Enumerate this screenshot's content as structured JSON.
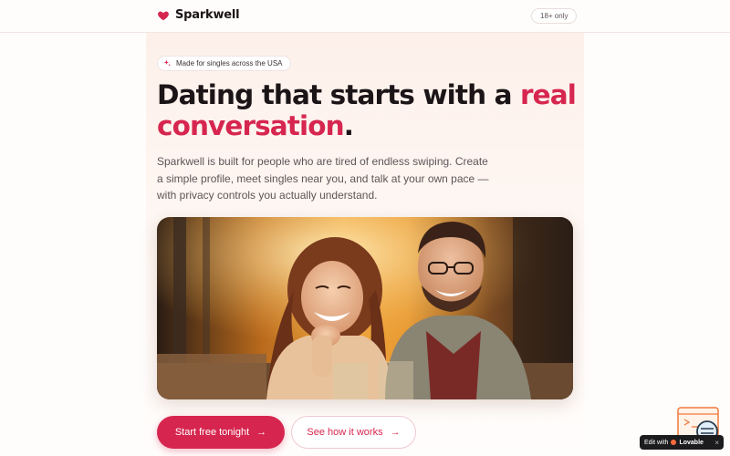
{
  "header": {
    "brand_name": "Sparkwell",
    "age_badge": "18+ only"
  },
  "hero": {
    "pill_text": "Made for singles across the USA",
    "headline_main": "Dating that starts with a ",
    "headline_accent": "real conversation",
    "headline_end": ".",
    "subtext": "Sparkwell is built for people who are tired of endless swiping. Create a simple profile, meet singles near you, and talk at your own pace — with privacy controls you actually understand.",
    "photo_alt": "Smiling couple at a cafe"
  },
  "cta": {
    "primary_label": "Start free tonight",
    "secondary_label": "See how it works",
    "arrow": "→"
  },
  "edit_badge": {
    "prefix": "Edit with",
    "name": "Lovable",
    "close": "×"
  },
  "colors": {
    "accent": "#d6264f",
    "text": "#1b1518",
    "muted": "#5d5557"
  },
  "icons": {
    "brand": "heart-icon",
    "pill": "sparkle-icon",
    "cta_arrow": "arrow-right-icon"
  }
}
